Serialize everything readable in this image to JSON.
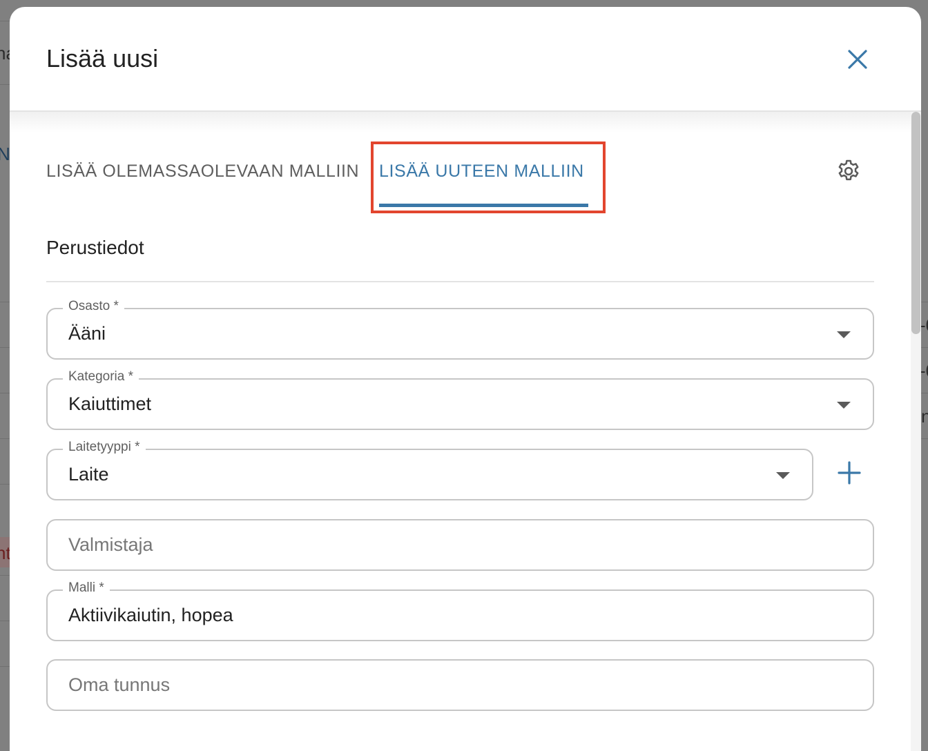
{
  "background": {
    "fragments": [
      "na",
      "N",
      "-0",
      "-0",
      "n",
      "nt"
    ]
  },
  "modal": {
    "title": "Lisää uusi",
    "close_icon": "close-icon"
  },
  "tabs": [
    {
      "label": "LISÄÄ OLEMASSAOLEVAAN MALLIIN",
      "active": false
    },
    {
      "label": "LISÄÄ UUTEEN MALLIIN",
      "active": true
    }
  ],
  "settings_icon": "gear-icon",
  "section": {
    "title": "Perustiedot"
  },
  "fields": {
    "osasto": {
      "label": "Osasto *",
      "value": "Ääni"
    },
    "kategoria": {
      "label": "Kategoria *",
      "value": "Kaiuttimet"
    },
    "laitetyyppi": {
      "label": "Laitetyyppi *",
      "value": "Laite"
    },
    "valmistaja": {
      "placeholder": "Valmistaja"
    },
    "malli": {
      "label": "Malli *",
      "value": "Aktiivikaiutin, hopea"
    },
    "oma_tunnus": {
      "placeholder": "Oma tunnus"
    }
  },
  "colors": {
    "accent": "#3a78a8",
    "highlight": "#e2452e",
    "overlay": "#808080"
  }
}
